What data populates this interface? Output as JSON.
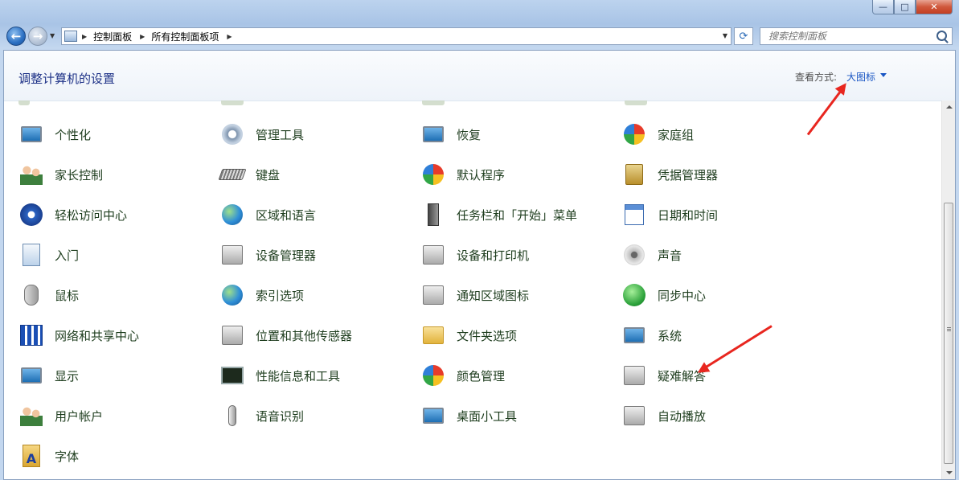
{
  "window": {
    "caption_buttons": [
      {
        "name": "minimize",
        "glyph": "—"
      },
      {
        "name": "maximize",
        "glyph": "□"
      },
      {
        "name": "close",
        "glyph": "✕"
      }
    ]
  },
  "nav": {
    "back_glyph": "←",
    "forward_glyph": "→",
    "history_glyph": "▼",
    "address_segments": [
      "控制面板",
      "所有控制面板项"
    ],
    "address_sep": "▶",
    "address_dropdown_glyph": "▼",
    "refresh_glyph": "⟳",
    "search_placeholder": "搜索控制面板"
  },
  "header": {
    "title": "调整计算机的设置",
    "view_label": "查看方式:",
    "view_value": "大图标"
  },
  "items": [
    {
      "label": "个性化",
      "icon": "personalization-icon"
    },
    {
      "label": "管理工具",
      "icon": "admin-tools-icon"
    },
    {
      "label": "恢复",
      "icon": "recovery-icon"
    },
    {
      "label": "家庭组",
      "icon": "homegroup-icon"
    },
    {
      "label": "家长控制",
      "icon": "parental-controls-icon"
    },
    {
      "label": "键盘",
      "icon": "keyboard-icon"
    },
    {
      "label": "默认程序",
      "icon": "default-programs-icon"
    },
    {
      "label": "凭据管理器",
      "icon": "credential-manager-icon"
    },
    {
      "label": "轻松访问中心",
      "icon": "ease-of-access-icon"
    },
    {
      "label": "区域和语言",
      "icon": "region-language-icon"
    },
    {
      "label": "任务栏和「开始」菜单",
      "icon": "taskbar-icon"
    },
    {
      "label": "日期和时间",
      "icon": "date-time-icon"
    },
    {
      "label": "入门",
      "icon": "getting-started-icon"
    },
    {
      "label": "设备管理器",
      "icon": "device-manager-icon"
    },
    {
      "label": "设备和打印机",
      "icon": "devices-printers-icon"
    },
    {
      "label": "声音",
      "icon": "sound-icon"
    },
    {
      "label": "鼠标",
      "icon": "mouse-icon"
    },
    {
      "label": "索引选项",
      "icon": "indexing-options-icon"
    },
    {
      "label": "通知区域图标",
      "icon": "notification-area-icon"
    },
    {
      "label": "同步中心",
      "icon": "sync-center-icon"
    },
    {
      "label": "网络和共享中心",
      "icon": "network-sharing-icon"
    },
    {
      "label": "位置和其他传感器",
      "icon": "location-sensors-icon"
    },
    {
      "label": "文件夹选项",
      "icon": "folder-options-icon"
    },
    {
      "label": "系统",
      "icon": "system-icon"
    },
    {
      "label": "显示",
      "icon": "display-icon"
    },
    {
      "label": "性能信息和工具",
      "icon": "performance-icon"
    },
    {
      "label": "颜色管理",
      "icon": "color-management-icon"
    },
    {
      "label": "疑难解答",
      "icon": "troubleshooting-icon"
    },
    {
      "label": "用户帐户",
      "icon": "user-accounts-icon"
    },
    {
      "label": "语音识别",
      "icon": "speech-recognition-icon"
    },
    {
      "label": "桌面小工具",
      "icon": "desktop-gadgets-icon"
    },
    {
      "label": "自动播放",
      "icon": "autoplay-icon"
    },
    {
      "label": "字体",
      "icon": "fonts-icon"
    }
  ],
  "colors": {
    "link": "#1a56c4",
    "title": "#1e3287",
    "annotation": "#e8261f"
  }
}
